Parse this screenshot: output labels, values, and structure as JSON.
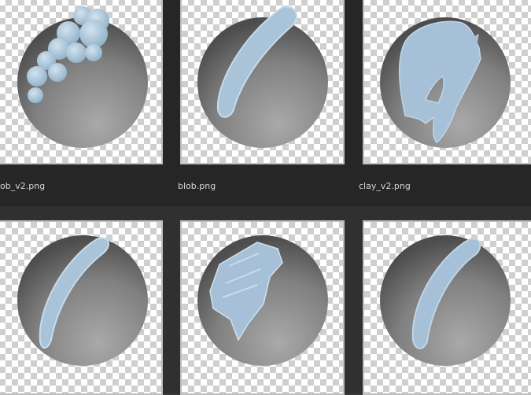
{
  "browser": {
    "thumbnails": [
      {
        "name": "",
        "brush": "blob-cluster-icon"
      },
      {
        "name": "",
        "brush": "smooth-stroke-icon"
      },
      {
        "name": "",
        "brush": "clay-loop-icon"
      },
      {
        "name": "",
        "brush": "thin-stroke-icon"
      },
      {
        "name": "",
        "brush": "flat-clay-icon"
      },
      {
        "name": "",
        "brush": "rough-stroke-icon"
      }
    ],
    "captions": [
      "ob_v2.png",
      "blob.png",
      "clay_v2.png"
    ]
  },
  "colors": {
    "background": "#383838",
    "panel": "#262626",
    "sphere_light": "#9e9e9e",
    "sphere_dark": "#4f4f4f",
    "brush_stroke": "#aac4d9",
    "caption_text": "#d6d6d6"
  }
}
